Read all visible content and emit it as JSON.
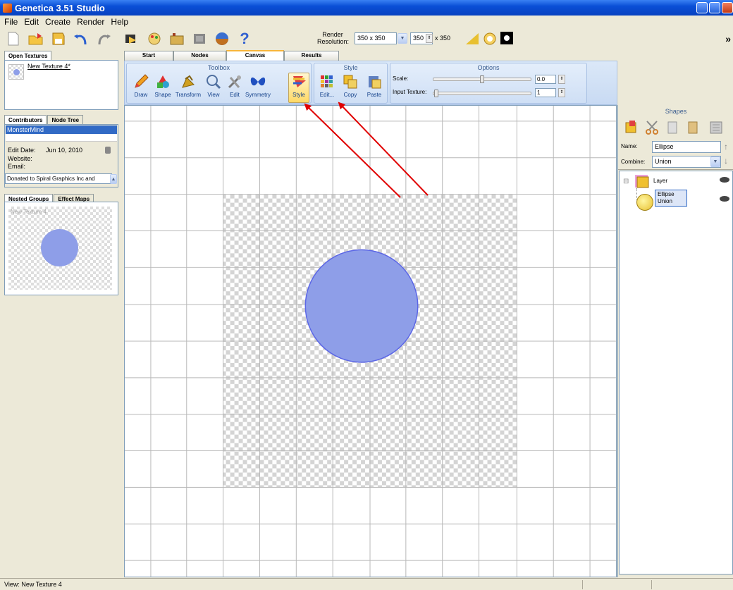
{
  "window": {
    "title": "Genetica 3.51 Studio"
  },
  "menu": [
    "File",
    "Edit",
    "Create",
    "Render",
    "Help"
  ],
  "toolbar": {
    "icons": [
      "new-icon",
      "open-icon",
      "save-icon",
      "undo-icon",
      "redo-icon",
      "render-icon",
      "palette-icon",
      "library-icon",
      "plugin-icon",
      "sphere-icon",
      "help-icon"
    ],
    "help_glyph": "?",
    "render_label": "Render Resolution:",
    "resolution_value": "350 x 350",
    "width_value": "350",
    "height_label": "x 350",
    "overflow_glyph": "»"
  },
  "open_textures": {
    "tab_label": "Open Textures",
    "item_name": "New Texture 4*"
  },
  "contributors": {
    "tabs": [
      "Contributors",
      "Node Tree"
    ],
    "selected": "MonsterMind",
    "edit_date_label": "Edit Date:",
    "edit_date_value": "Jun 10, 2010",
    "website_label": "Website:",
    "email_label": "Email:",
    "donated_text": "Donated to Spiral Graphics Inc and"
  },
  "nested_groups": {
    "tabs": [
      "Nested Groups",
      "Effect Maps"
    ],
    "preview_label": "New Texture 4"
  },
  "main_tabs": [
    "Start",
    "Nodes",
    "Canvas",
    "Results"
  ],
  "ribbon": {
    "toolbox_title": "Toolbox",
    "toolbox_buttons": [
      "Draw",
      "Shape",
      "Transform",
      "View",
      "Edit",
      "Symmetry",
      "Style"
    ],
    "style_title": "Style",
    "style_buttons": [
      "Edit...",
      "Copy",
      "Paste"
    ],
    "options_title": "Options",
    "scale_label": "Scale:",
    "scale_value": "0.0",
    "input_texture_label": "Input Texture:",
    "input_texture_value": "1"
  },
  "canvas": {
    "shape_color": "#8e9ee8",
    "shape_stroke": "#5b66e6",
    "annotation_color": "#e00000"
  },
  "shapes_panel": {
    "title": "Shapes",
    "name_label": "Name:",
    "name_value": "Ellipse",
    "combine_label": "Combine:",
    "combine_value": "Union",
    "tree": {
      "layer_label": "Layer",
      "item_line1": "Ellipse",
      "item_line2": "Union",
      "expander": "⊟"
    }
  },
  "status": {
    "text": "View: New Texture 4"
  }
}
